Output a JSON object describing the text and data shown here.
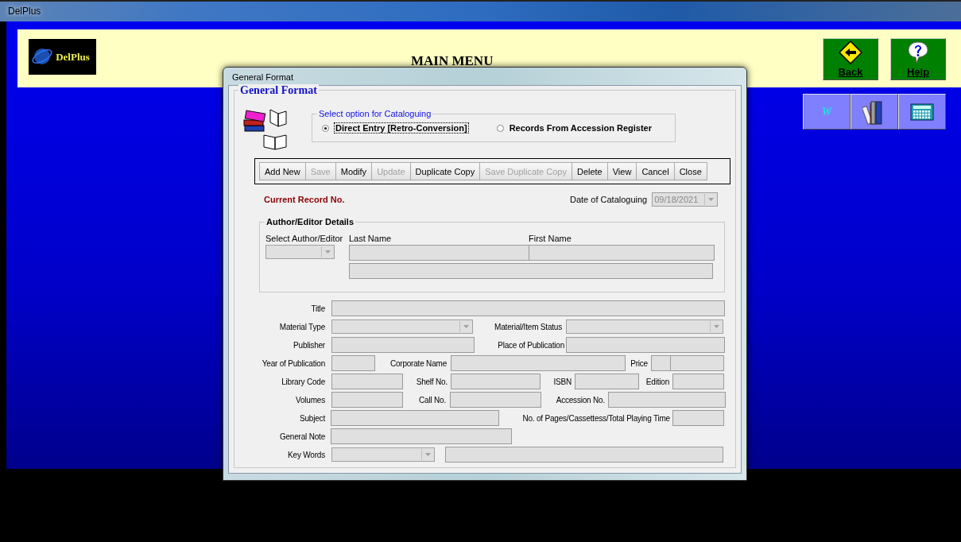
{
  "main_window": {
    "title": "DelPlus",
    "logo": "DelPlus",
    "heading": "MAIN MENU",
    "nav_buttons": [
      {
        "kind": "back",
        "label": "Back"
      },
      {
        "kind": "help",
        "label": "Help"
      }
    ],
    "tool_buttons": [
      {
        "kind": "glyph",
        "glyph": "W"
      },
      {
        "kind": "books"
      },
      {
        "kind": "calculator"
      }
    ]
  },
  "dialog": {
    "title": "General Format",
    "group_title": "General Format",
    "option_group": {
      "legend": "Select option for Cataloguing",
      "options": [
        {
          "label": "Direct Entry [Retro-Conversion]",
          "selected": true
        },
        {
          "label": "Records From Accession Register",
          "selected": false
        }
      ]
    },
    "toolbar": [
      {
        "label": "Add New",
        "disabled": false
      },
      {
        "label": "Save",
        "disabled": true
      },
      {
        "label": "Modify",
        "disabled": false
      },
      {
        "label": "Update",
        "disabled": true
      },
      {
        "label": "Duplicate Copy",
        "disabled": false
      },
      {
        "label": "Save Duplicate Copy",
        "disabled": true
      },
      {
        "label": "Delete",
        "disabled": false
      },
      {
        "label": "View",
        "disabled": false
      },
      {
        "label": "Cancel",
        "disabled": false
      },
      {
        "label": "Close",
        "disabled": false
      }
    ],
    "current_record_label": "Current Record No.",
    "date_label": "Date of Cataloguing",
    "date_value": "09/18/2021",
    "author_group": {
      "legend": "Author/Editor Details",
      "select_label": "Select Author/Editor",
      "last_name_label": "Last Name",
      "first_name_label": "First Name"
    },
    "rows": [
      [
        {
          "label": "Title",
          "kind": "text"
        }
      ],
      [
        {
          "label": "Material Type",
          "kind": "combo"
        },
        {
          "label": "Material/Item Status",
          "kind": "combo"
        }
      ],
      [
        {
          "label": "Publisher",
          "kind": "text"
        },
        {
          "label": "Place of Publication",
          "kind": "text"
        }
      ],
      [
        {
          "label": "Year of Publication",
          "kind": "text"
        },
        {
          "label": "Corporate Name",
          "kind": "text"
        },
        {
          "label": "Price",
          "kind": "split"
        }
      ],
      [
        {
          "label": "Library Code",
          "kind": "text"
        },
        {
          "label": "Shelf No.",
          "kind": "text"
        },
        {
          "label": "ISBN",
          "kind": "text"
        },
        {
          "label": "Edition",
          "kind": "text"
        }
      ],
      [
        {
          "label": "Volumes",
          "kind": "text"
        },
        {
          "label": "Call No.",
          "kind": "text"
        },
        {
          "label": "Accession No.",
          "kind": "text"
        }
      ],
      [
        {
          "label": "Subject",
          "kind": "text"
        },
        {
          "label": "No. of Pages/Cassettess/Total Playing Time",
          "kind": "text"
        }
      ],
      [
        {
          "label": "General Note",
          "kind": "text"
        }
      ],
      [
        {
          "label": "Key Words",
          "kind": "combo"
        },
        {
          "kind": "text"
        }
      ]
    ]
  }
}
